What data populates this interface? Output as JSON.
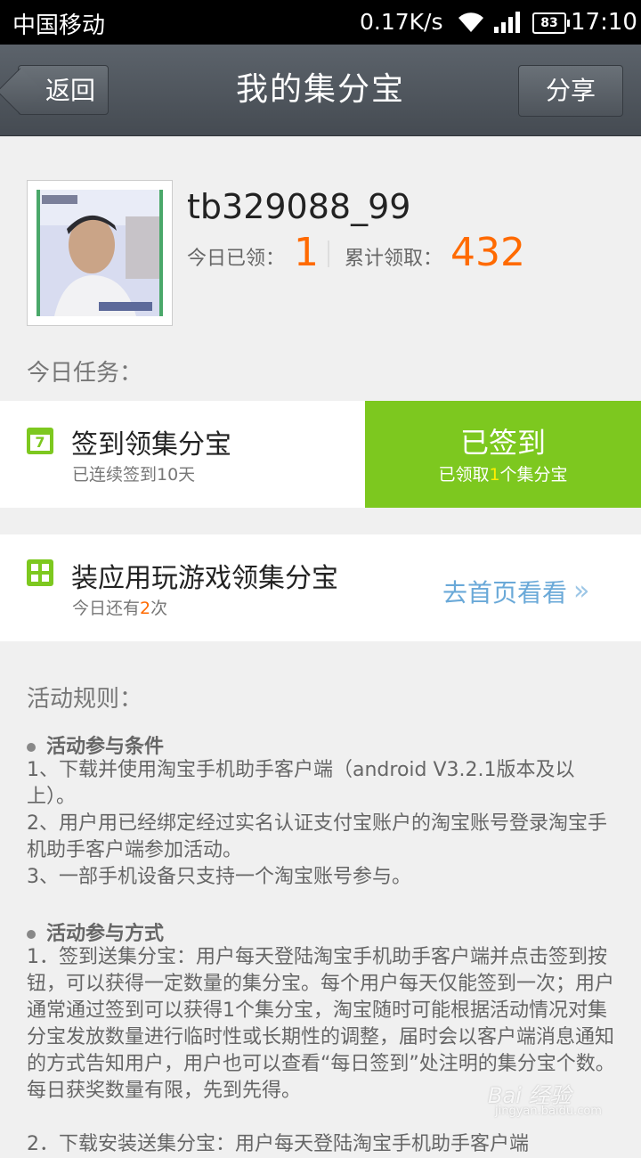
{
  "status_bar": {
    "carrier": "中国移动",
    "speed": "0.17K/s",
    "battery": "83",
    "time": "17:10"
  },
  "header": {
    "back_label": "返回",
    "title": "我的集分宝",
    "share_label": "分享"
  },
  "profile": {
    "username": "tb329088_99",
    "today_label": "今日已领：",
    "today_value": "1",
    "total_label": "累计领取：",
    "total_value": "432"
  },
  "tasks_heading": "今日任务：",
  "task_signin": {
    "title": "签到领集分宝",
    "subtitle": "已连续签到10天",
    "calendar_day": "7",
    "button_title": "已签到",
    "button_sub_prefix": "已领取",
    "button_sub_count": "1",
    "button_sub_suffix": "个集分宝"
  },
  "task_apps": {
    "title": "装应用玩游戏领集分宝",
    "sub_prefix": "今日还有",
    "sub_count": "2",
    "sub_suffix": "次",
    "link_label": "去首页看看",
    "link_chevron": "»"
  },
  "rules": {
    "heading": "活动规则：",
    "section1_title": "活动参与条件",
    "section1_lines": [
      "1、下载并使用淘宝手机助手客户端（android V3.2.1版本及以上）。",
      "2、用户用已经绑定经过实名认证支付宝账户的淘宝账号登录淘宝手机助手客户端参加活动。",
      "3、一部手机设备只支持一个淘宝账号参与。"
    ],
    "section2_title": "活动参与方式",
    "section2_lines": [
      "1．签到送集分宝：用户每天登陆淘宝手机助手客户端并点击签到按钮，可以获得一定数量的集分宝。每个用户每天仅能签到一次；用户通常通过签到可以获得1个集分宝，淘宝随时可能根据活动情况对集分宝发放数量进行临时性或长期性的调整，届时会以客户端消息通知的方式告知用户，用户也可以查看“每日签到”处注明的集分宝个数。每日获奖数量有限，先到先得。",
      "2．下载安装送集分宝：用户每天登陆淘宝手机助手客户端"
    ]
  },
  "watermark": {
    "text": "Bai 经验",
    "sub": "jingyan.baidu.com"
  }
}
